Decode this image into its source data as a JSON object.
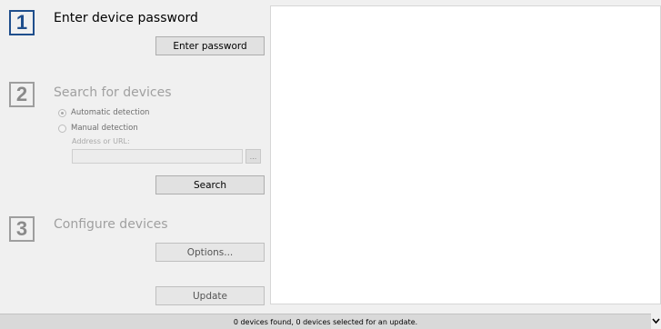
{
  "steps": [
    {
      "number": "1",
      "title": "Enter device password",
      "button": "Enter password"
    },
    {
      "number": "2",
      "title": "Search for devices",
      "options": [
        "Automatic detection",
        "Manual detection"
      ],
      "selected_option": "Automatic detection",
      "address_label": "Address or URL:",
      "address_value": "",
      "browse_label": "...",
      "button": "Search"
    },
    {
      "number": "3",
      "title": "Configure devices",
      "options_button": "Options...",
      "update_button": "Update"
    }
  ],
  "status": "0 devices found, 0 devices selected for an update.",
  "colors": {
    "active_step": "#1f4e8c",
    "inactive_step": "#8a8a8a"
  },
  "icons": {
    "expand": "chevron-down-icon"
  }
}
